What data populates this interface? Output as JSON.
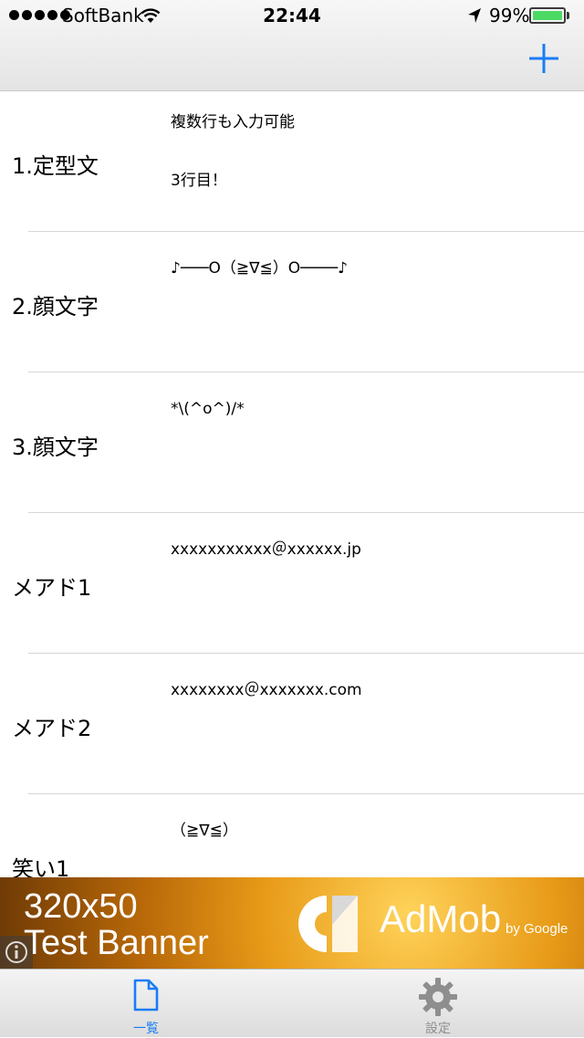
{
  "status_bar": {
    "carrier": "SoftBank",
    "time": "22:44",
    "battery_percent": "99%",
    "battery_level": 0.99,
    "signal_dots": 5
  },
  "nav": {
    "add_icon": "plus-icon"
  },
  "rows": [
    {
      "title": "1.定型文",
      "content": "複数行も入力可能\n\n3行目！"
    },
    {
      "title": "2.顔文字",
      "content": "♪───O（≧∇≦）O────♪"
    },
    {
      "title": "3.顔文字",
      "content": "*\\(^o^)/*"
    },
    {
      "title": "メアド1",
      "content": "xxxxxxxxxxx＠xxxxxx.jp"
    },
    {
      "title": "メアド2",
      "content": "xxxxxxxx＠xxxxxxx.com"
    },
    {
      "title": "笑い1",
      "content": "（≧∇≦）"
    }
  ],
  "ad": {
    "line1": "320x50",
    "line2": "Test Banner",
    "brand": "AdMob",
    "by": "by Google",
    "info_icon": "info-icon"
  },
  "tabs": [
    {
      "label": "一覧",
      "icon": "document-icon",
      "selected": true
    },
    {
      "label": "設定",
      "icon": "gear-icon",
      "selected": false
    }
  ],
  "colors": {
    "accent": "#1a7cf5",
    "inactive_tab": "#8e8e8e",
    "separator": "#d6d6d6",
    "battery_fill": "#4cd964"
  }
}
